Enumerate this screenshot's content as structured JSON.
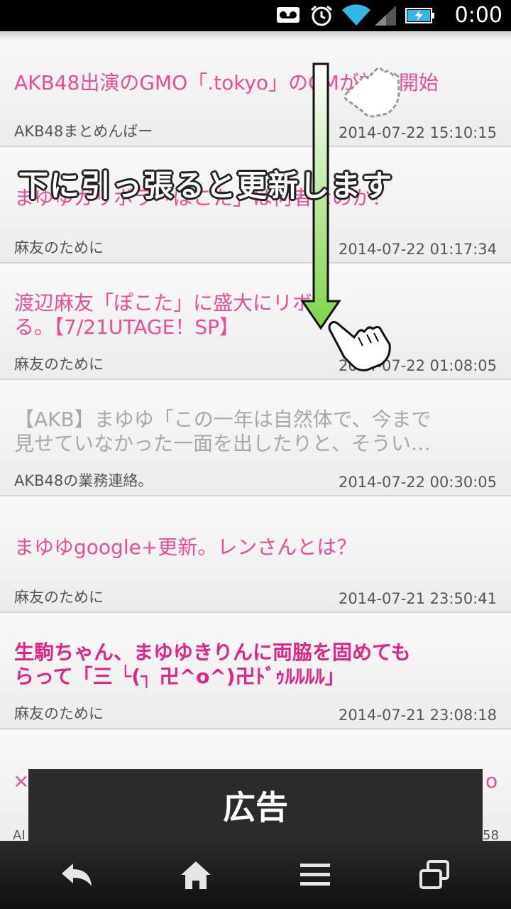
{
  "status_bar": {
    "time": "0:00",
    "icons": [
      "voicemail-icon",
      "alarm-icon",
      "wifi-icon",
      "signal-icon",
      "battery-charging-icon"
    ]
  },
  "articles": [
    {
      "title": "AKB48出演のGMO「.tokyo」のCMが放送開始",
      "source": "AKB48まとめんばー",
      "date": "2014-07-22 15:10:15",
      "style": "normal"
    },
    {
      "title": "まゆゆガリボラ「ぽこた」は何者なのか？",
      "source": "麻友のために",
      "date": "2014-07-22 01:17:34",
      "style": "normal"
    },
    {
      "title": "渡辺麻友「ぽこた」に盛大にリボ\nる。【7/21UTAGE！SP】",
      "source": "麻友のために",
      "date": "2014-07-22 01:08:05",
      "style": "normal"
    },
    {
      "title": "【AKB】まゆゆ「この一年は自然体で、今まで\n見せていなかった一面を出したりと、そうい…",
      "source": "AKB48の業務連絡。",
      "date": "2014-07-22 00:30:05",
      "style": "read"
    },
    {
      "title": "まゆゆgoogle+更新。レンさんとは？",
      "source": "麻友のために",
      "date": "2014-07-21 23:50:41",
      "style": "normal"
    },
    {
      "title": "生駒ちゃん、まゆゆきりんに両脇を固めても\nらって「三 └(┐ 卍^o^)卍ﾄﾞｩﾙﾙﾙﾙ」",
      "source": "麻友のために",
      "date": "2014-07-21 23:08:18",
      "style": "bold"
    }
  ],
  "overlay": {
    "hint": "下に引っ張ると更新します"
  },
  "ad": {
    "label": "広告",
    "peek_left": "×",
    "peek_right": "o",
    "peek_left_meta": "AI",
    "peek_right_meta": "58"
  },
  "nav": {
    "icons": [
      "back-icon",
      "home-icon",
      "menu-icon",
      "recent-apps-icon"
    ]
  },
  "colors": {
    "title_pink": "#e94d9a",
    "title_bold_pink": "#e0248a",
    "read_gray": "#a8a8a8",
    "arrow_green": "#7fd34a"
  }
}
